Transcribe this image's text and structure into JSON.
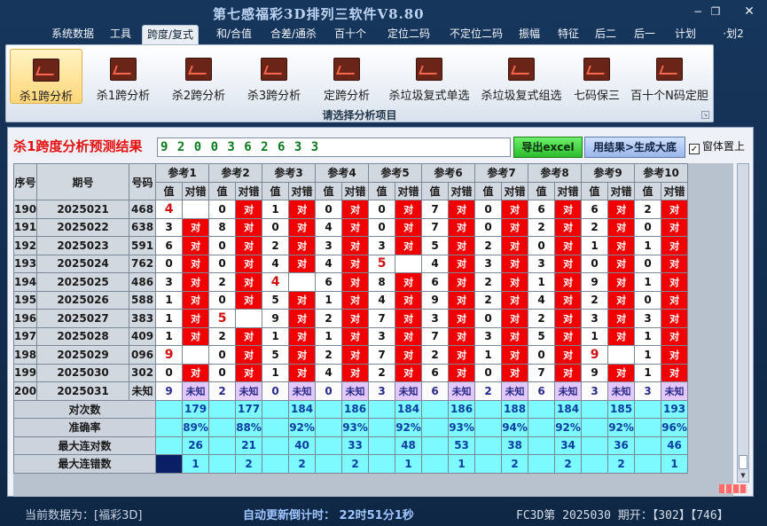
{
  "window": {
    "title": "第七感福彩3D排列三软件V8.80",
    "buttons": [
      "−",
      "❐",
      "✕"
    ]
  },
  "menu": [
    "系统数据",
    "工具",
    "跨度/复式",
    "和/合值",
    "合差/通杀",
    "百十个",
    "定位二码",
    "不定位二码",
    "振幅",
    "特征",
    "后二",
    "后一",
    "计划",
    "·划2"
  ],
  "menu_active": 2,
  "ribbon": {
    "buttons": [
      "杀1跨分析",
      "杀1跨分析",
      "杀2跨分析",
      "杀3跨分析",
      "定跨分析",
      "杀垃圾复式单选",
      "杀垃圾复式组选",
      "七码保三",
      "百十个N码定胆"
    ],
    "active": 0,
    "caption": "请选择分析项目"
  },
  "panel": {
    "title": "杀1跨度分析预测结果",
    "result": "9 2 0 0 3 6 2 6 3 3",
    "export_label": "导出excel",
    "generate_label": "用结果>生成大底",
    "ontop_label": "窗体置上",
    "ontop_checked": "✓"
  },
  "grid": {
    "header_idx": "序号",
    "header_period": "期号",
    "header_code": "号码",
    "ref_labels": [
      "参考1",
      "参考2",
      "参考3",
      "参考4",
      "参考5",
      "参考6",
      "参考7",
      "参考8",
      "参考9",
      "参考10"
    ],
    "sub_value": "值",
    "sub_result": "对错",
    "correct_mark": "对",
    "rows": [
      {
        "idx": "190",
        "period": "2025021",
        "code": "468",
        "values": [
          "4",
          "0",
          "1",
          "0",
          "0",
          "7",
          "0",
          "6",
          "6",
          "2"
        ],
        "hits": [
          0,
          1,
          1,
          1,
          1,
          1,
          1,
          1,
          1,
          1
        ]
      },
      {
        "idx": "191",
        "period": "2025022",
        "code": "638",
        "values": [
          "3",
          "8",
          "0",
          "4",
          "0",
          "7",
          "0",
          "2",
          "2",
          "0"
        ],
        "hits": [
          1,
          1,
          1,
          1,
          1,
          1,
          1,
          1,
          1,
          1
        ]
      },
      {
        "idx": "192",
        "period": "2025023",
        "code": "591",
        "values": [
          "6",
          "0",
          "2",
          "3",
          "3",
          "5",
          "2",
          "0",
          "1",
          "1"
        ],
        "hits": [
          1,
          1,
          1,
          1,
          1,
          1,
          1,
          1,
          1,
          1
        ]
      },
      {
        "idx": "193",
        "period": "2025024",
        "code": "762",
        "values": [
          "0",
          "0",
          "4",
          "4",
          "5",
          "4",
          "3",
          "3",
          "0",
          "0"
        ],
        "hits": [
          1,
          1,
          1,
          1,
          0,
          1,
          1,
          1,
          1,
          1
        ]
      },
      {
        "idx": "194",
        "period": "2025025",
        "code": "486",
        "values": [
          "3",
          "2",
          "4",
          "6",
          "8",
          "6",
          "2",
          "1",
          "9",
          "1"
        ],
        "hits": [
          1,
          1,
          0,
          1,
          1,
          1,
          1,
          1,
          1,
          1
        ]
      },
      {
        "idx": "195",
        "period": "2025026",
        "code": "588",
        "values": [
          "1",
          "0",
          "5",
          "1",
          "4",
          "9",
          "2",
          "4",
          "2",
          "0"
        ],
        "hits": [
          1,
          1,
          1,
          1,
          1,
          1,
          1,
          1,
          1,
          1
        ]
      },
      {
        "idx": "196",
        "period": "2025027",
        "code": "383",
        "values": [
          "1",
          "5",
          "9",
          "2",
          "7",
          "3",
          "0",
          "2",
          "3",
          "3"
        ],
        "hits": [
          1,
          0,
          1,
          1,
          1,
          1,
          1,
          1,
          1,
          1
        ]
      },
      {
        "idx": "197",
        "period": "2025028",
        "code": "409",
        "values": [
          "1",
          "2",
          "1",
          "1",
          "3",
          "7",
          "3",
          "5",
          "1",
          "1"
        ],
        "hits": [
          1,
          1,
          1,
          1,
          1,
          1,
          1,
          1,
          1,
          1
        ]
      },
      {
        "idx": "198",
        "period": "2025029",
        "code": "096",
        "values": [
          "9",
          "0",
          "5",
          "2",
          "7",
          "2",
          "1",
          "0",
          "9",
          "1"
        ],
        "hits": [
          0,
          1,
          1,
          1,
          1,
          1,
          1,
          1,
          0,
          1
        ]
      },
      {
        "idx": "199",
        "period": "2025030",
        "code": "302",
        "values": [
          "0",
          "0",
          "1",
          "4",
          "2",
          "6",
          "0",
          "7",
          "9",
          "1"
        ],
        "hits": [
          1,
          1,
          1,
          1,
          1,
          1,
          1,
          1,
          1,
          1
        ]
      }
    ],
    "red_values": [
      [
        0,
        0
      ],
      [
        3,
        4
      ],
      [
        4,
        2
      ],
      [
        6,
        1
      ],
      [
        8,
        0
      ],
      [
        8,
        8
      ]
    ],
    "predict_row": {
      "idx": "200",
      "period": "2025031",
      "code": "未知",
      "values": [
        "9",
        "2",
        "0",
        "0",
        "3",
        "6",
        "2",
        "6",
        "3",
        "3"
      ],
      "unknown_label": "未知"
    },
    "stats": [
      {
        "label": "对次数",
        "values": [
          "179",
          "177",
          "184",
          "186",
          "184",
          "186",
          "188",
          "184",
          "185",
          "193"
        ]
      },
      {
        "label": "准确率",
        "values": [
          "89%",
          "88%",
          "92%",
          "93%",
          "92%",
          "93%",
          "94%",
          "92%",
          "92%",
          "96%"
        ]
      },
      {
        "label": "最大连对数",
        "values": [
          "26",
          "21",
          "40",
          "33",
          "48",
          "53",
          "38",
          "34",
          "36",
          "46"
        ]
      },
      {
        "label": "最大连错数",
        "values": [
          "1",
          "2",
          "2",
          "2",
          "1",
          "1",
          "2",
          "2",
          "2",
          "1"
        ]
      }
    ]
  },
  "status": {
    "current": "当前数据为：[福彩3D]",
    "countdown": "自动更新倒计时：  22时51分1秒",
    "fc3d": "FC3D第 2025030 期开：【302】【746】"
  }
}
